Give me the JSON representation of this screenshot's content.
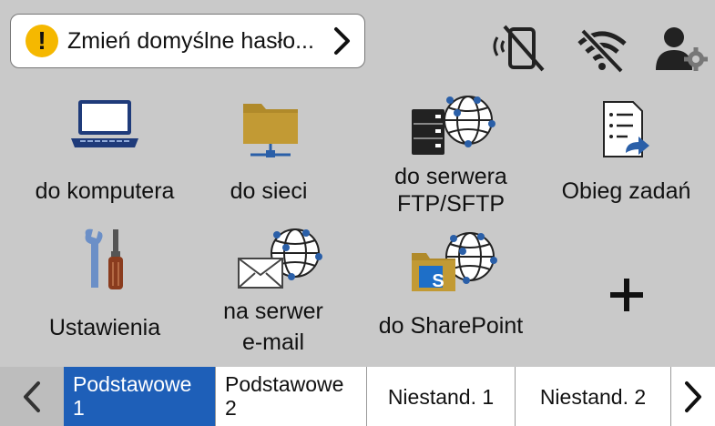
{
  "alert": {
    "icon": "warning-icon",
    "text": "Zmień domyślne hasło...",
    "icon_color": "#f5b800"
  },
  "status": {
    "icons": [
      "nfc-disabled-icon",
      "wifi-disabled-icon",
      "user-settings-icon"
    ]
  },
  "tiles": [
    {
      "icon": "laptop-icon",
      "label": "do komputera"
    },
    {
      "icon": "network-folder-icon",
      "label": "do sieci"
    },
    {
      "icon": "ftp-server-icon",
      "label_line1": "do serwera",
      "label_line2": "FTP/SFTP"
    },
    {
      "icon": "workflow-icon",
      "label": "Obieg zadań"
    },
    {
      "icon": "tools-icon",
      "label": "Ustawienia"
    },
    {
      "icon": "email-server-icon",
      "label_line1": "na serwer",
      "label_line2": "e-mail"
    },
    {
      "icon": "sharepoint-icon",
      "label": "do SharePoint"
    },
    {
      "icon": "plus-icon",
      "label": ""
    }
  ],
  "tabs": [
    {
      "line1": "Podstawowe",
      "line2": "1",
      "selected": true
    },
    {
      "line1": "Podstawowe",
      "line2": "2",
      "selected": false
    },
    {
      "label": "Niestand. 1",
      "selected": false
    },
    {
      "label": "Niestand. 2",
      "selected": false
    }
  ],
  "colors": {
    "background": "#c9c9c9",
    "selected_tab": "#1e5fb8",
    "accent_blue": "#2a5fa8",
    "folder": "#b08a2a"
  }
}
